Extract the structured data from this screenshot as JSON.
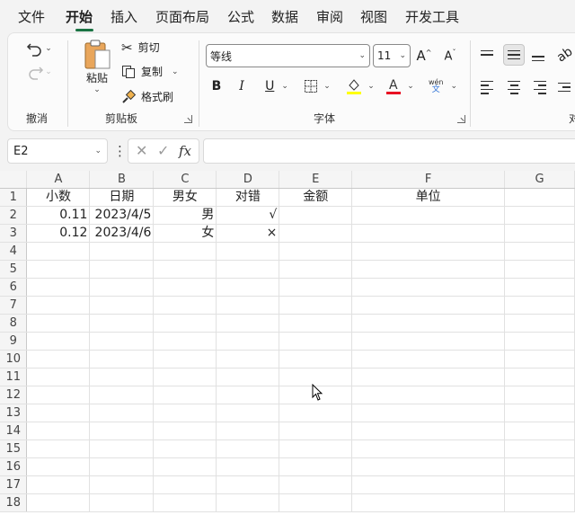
{
  "menu": {
    "tabs": [
      {
        "label": "文件"
      },
      {
        "label": "开始"
      },
      {
        "label": "插入"
      },
      {
        "label": "页面布局"
      },
      {
        "label": "公式"
      },
      {
        "label": "数据"
      },
      {
        "label": "审阅"
      },
      {
        "label": "视图"
      },
      {
        "label": "开发工具"
      }
    ],
    "active_tab": "开始"
  },
  "ribbon": {
    "undo_group": {
      "label": "撤消"
    },
    "clipboard": {
      "label": "剪贴板",
      "paste": "粘贴",
      "cut": "剪切",
      "copy": "复制",
      "format_painter": "格式刷"
    },
    "font": {
      "label": "字体",
      "font_name": "等线",
      "font_size": "11",
      "phonetic_top": "wén",
      "phonetic_bottom": "文",
      "highlight_color": "#ffff00",
      "font_color": "#e81123"
    },
    "alignment": {
      "label": "对"
    }
  },
  "formula_bar": {
    "name_box": "E2",
    "more": "⋮",
    "cancel": "✕",
    "enter": "✓",
    "fx": "fx",
    "formula": ""
  },
  "sheet": {
    "columns": [
      "A",
      "B",
      "C",
      "D",
      "E",
      "F",
      "G"
    ],
    "rows": [
      {
        "n": "1",
        "cells": [
          "小数",
          "日期",
          "男女",
          "对错",
          "金额",
          "单位",
          ""
        ]
      },
      {
        "n": "2",
        "cells": [
          "0.11",
          "2023/4/5",
          "男",
          "√",
          "",
          "",
          ""
        ]
      },
      {
        "n": "3",
        "cells": [
          "0.12",
          "2023/4/6",
          "女",
          "×",
          "",
          "",
          ""
        ]
      },
      {
        "n": "4",
        "cells": [
          "",
          "",
          "",
          "",
          "",
          "",
          ""
        ]
      },
      {
        "n": "5",
        "cells": [
          "",
          "",
          "",
          "",
          "",
          "",
          ""
        ]
      },
      {
        "n": "6",
        "cells": [
          "",
          "",
          "",
          "",
          "",
          "",
          ""
        ]
      },
      {
        "n": "7",
        "cells": [
          "",
          "",
          "",
          "",
          "",
          "",
          ""
        ]
      },
      {
        "n": "8",
        "cells": [
          "",
          "",
          "",
          "",
          "",
          "",
          ""
        ]
      },
      {
        "n": "9",
        "cells": [
          "",
          "",
          "",
          "",
          "",
          "",
          ""
        ]
      },
      {
        "n": "10",
        "cells": [
          "",
          "",
          "",
          "",
          "",
          "",
          ""
        ]
      },
      {
        "n": "11",
        "cells": [
          "",
          "",
          "",
          "",
          "",
          "",
          ""
        ]
      },
      {
        "n": "12",
        "cells": [
          "",
          "",
          "",
          "",
          "",
          "",
          ""
        ]
      },
      {
        "n": "13",
        "cells": [
          "",
          "",
          "",
          "",
          "",
          "",
          ""
        ]
      },
      {
        "n": "14",
        "cells": [
          "",
          "",
          "",
          "",
          "",
          "",
          ""
        ]
      },
      {
        "n": "15",
        "cells": [
          "",
          "",
          "",
          "",
          "",
          "",
          ""
        ]
      },
      {
        "n": "16",
        "cells": [
          "",
          "",
          "",
          "",
          "",
          "",
          ""
        ]
      },
      {
        "n": "17",
        "cells": [
          "",
          "",
          "",
          "",
          "",
          "",
          ""
        ]
      },
      {
        "n": "18",
        "cells": [
          "",
          "",
          "",
          "",
          "",
          "",
          ""
        ]
      }
    ]
  },
  "colors": {
    "accent": "#1a7343"
  }
}
